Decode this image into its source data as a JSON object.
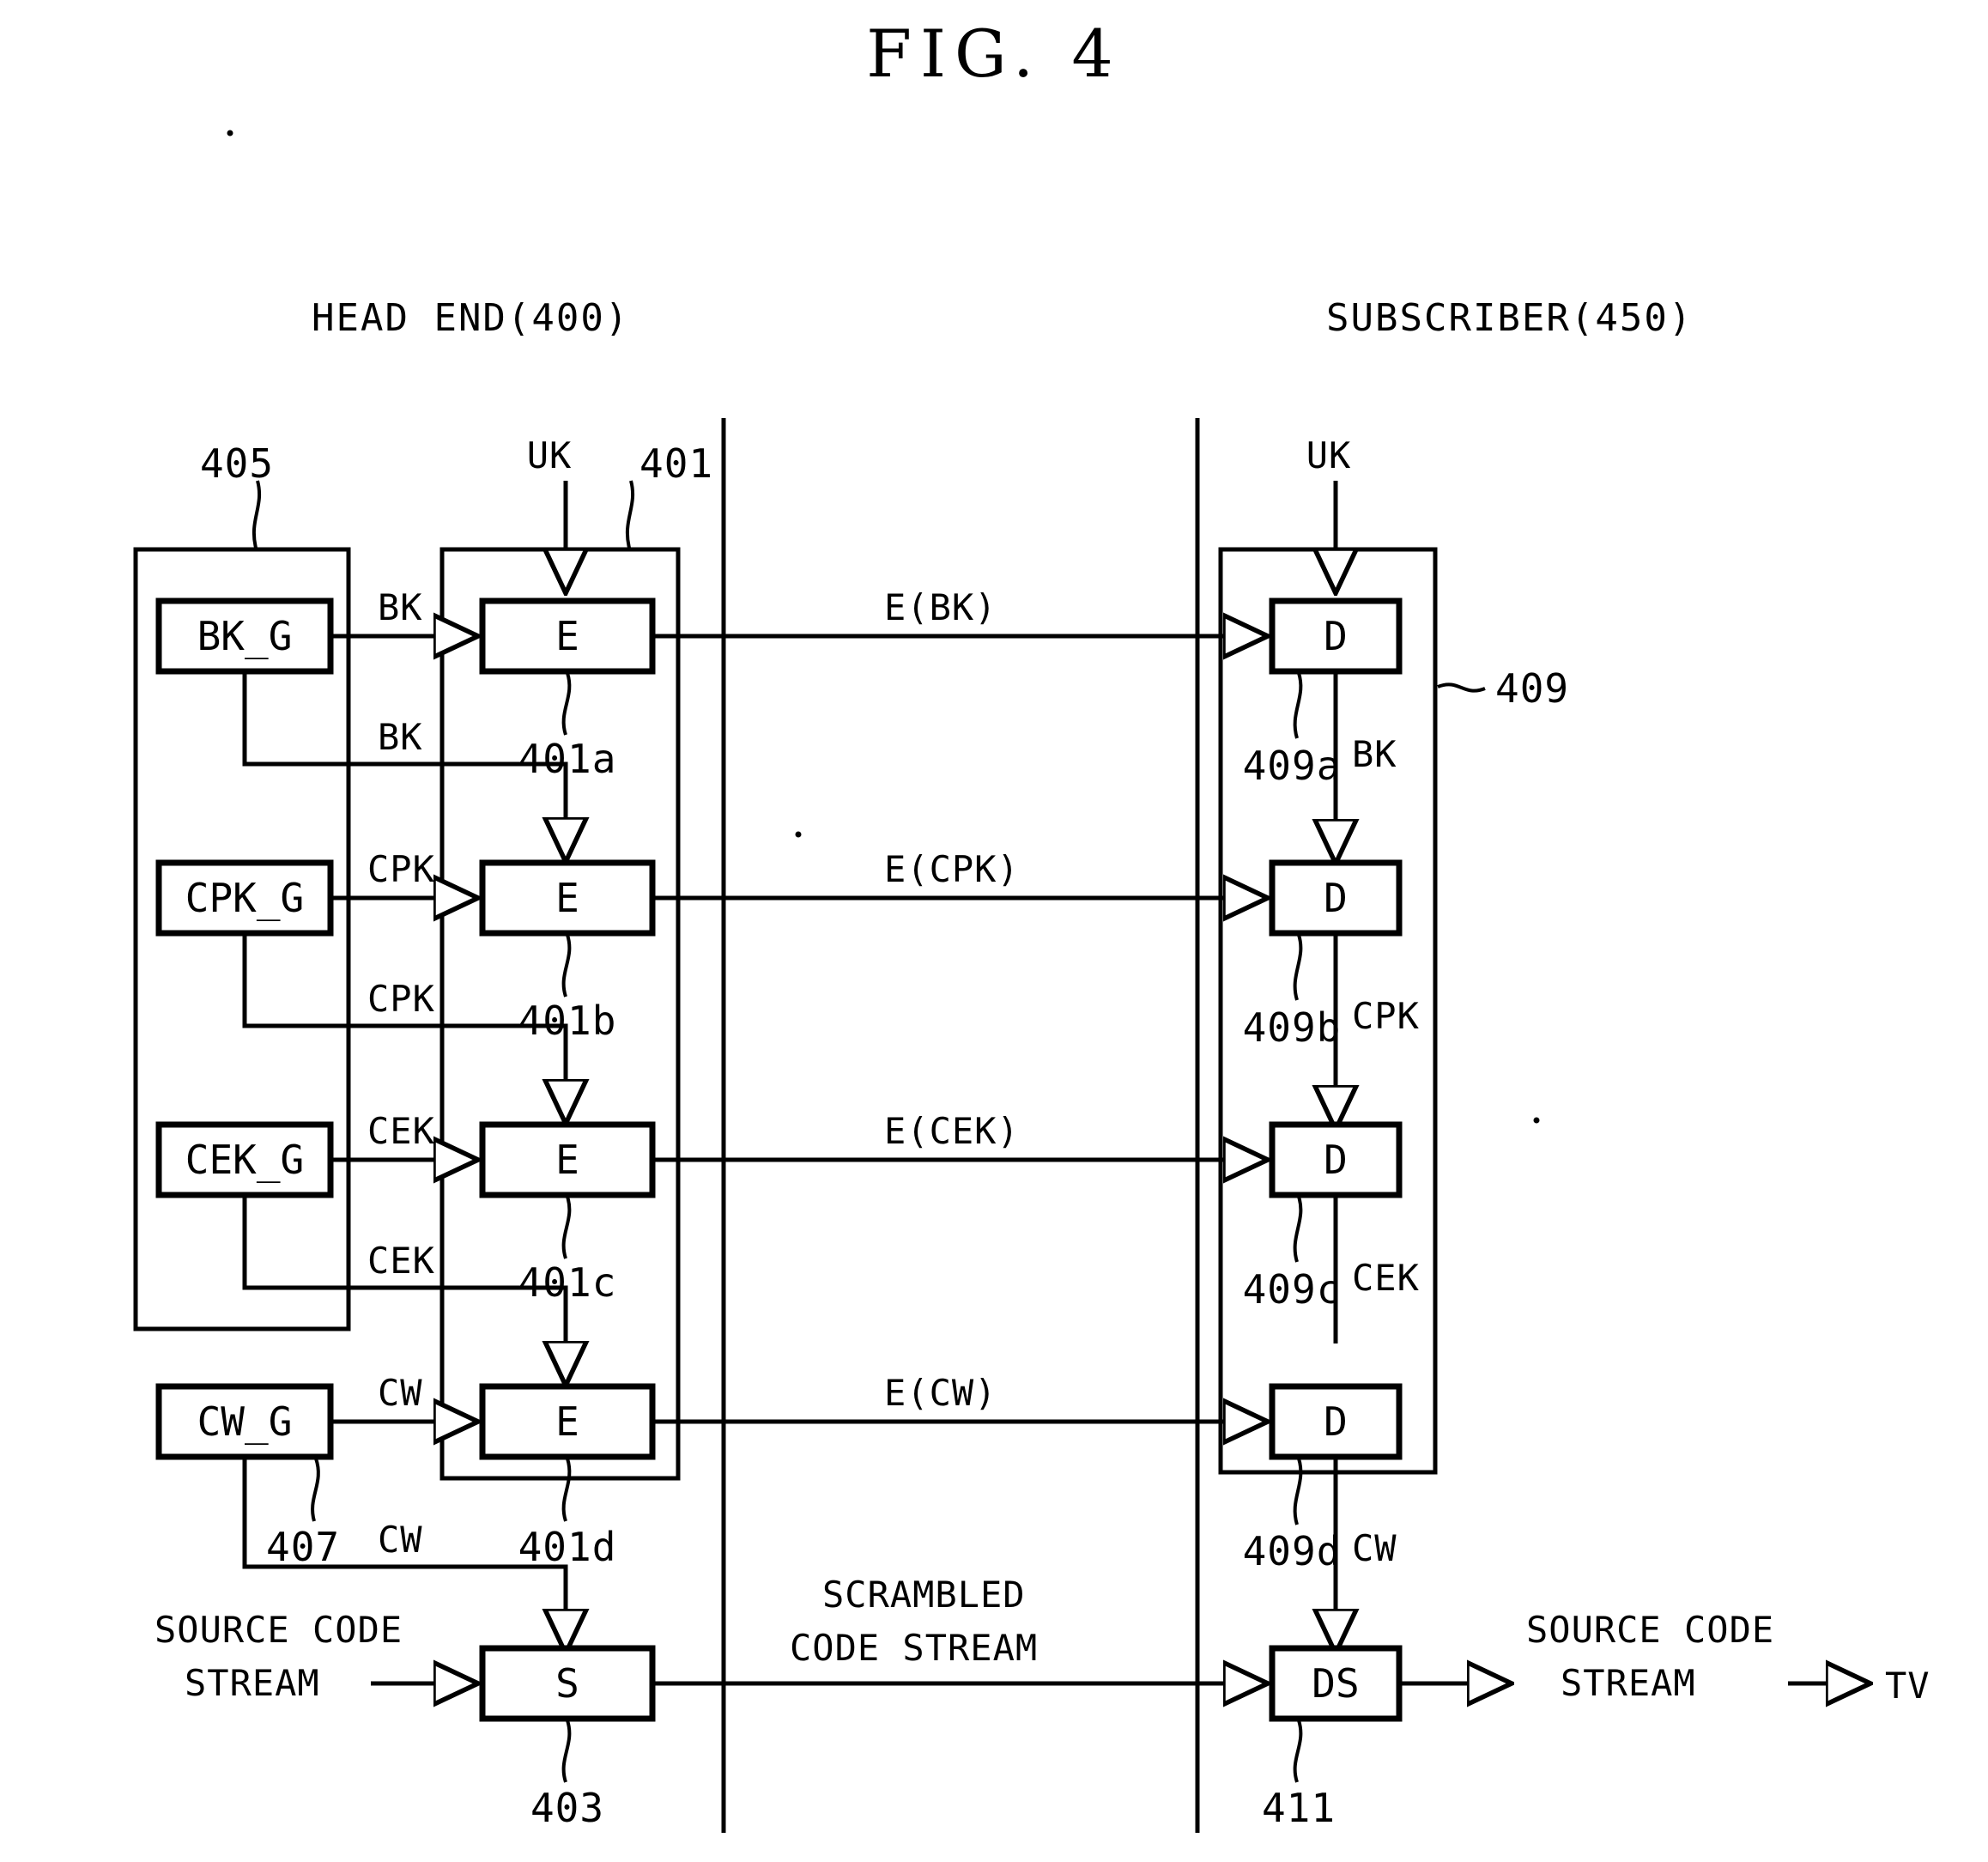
{
  "figure": {
    "title": "FIG. 4",
    "type": "patent-block-diagram"
  },
  "sections": {
    "left_header": "HEAD END(400)",
    "right_header": "SUBSCRIBER(450)"
  },
  "head_end": {
    "generator_group_ref": "405",
    "encryptor_group_ref": "401",
    "generators": [
      {
        "label": "BK_G",
        "out_signal": "BK"
      },
      {
        "label": "CPK_G",
        "out_signal": "CPK"
      },
      {
        "label": "CEK_G",
        "out_signal": "CEK"
      },
      {
        "label": "CW_G",
        "out_signal": "CW",
        "ref": "407"
      }
    ],
    "encryptors": [
      {
        "label": "E",
        "ref": "401a",
        "key_in": "UK",
        "out": "E(BK)"
      },
      {
        "label": "E",
        "ref": "401b",
        "key_in": "BK",
        "out": "E(CPK)"
      },
      {
        "label": "E",
        "ref": "401c",
        "key_in": "CPK",
        "out": "E(CEK)"
      },
      {
        "label": "E",
        "ref": "401d",
        "key_in": "CEK",
        "out": "E(CW)"
      }
    ],
    "scrambler": {
      "label": "S",
      "ref": "403",
      "key_in": "CW",
      "in_text_line1": "SOURCE CODE",
      "in_text_line2": "STREAM"
    },
    "uk_label": "UK"
  },
  "channel": {
    "streams": [
      "E(BK)",
      "E(CPK)",
      "E(CEK)",
      "E(CW)"
    ],
    "scrambled_line1": "SCRAMBLED",
    "scrambled_line2": "CODE STREAM"
  },
  "subscriber": {
    "decryptor_group_ref": "409",
    "uk_label": "UK",
    "decryptors": [
      {
        "label": "D",
        "ref": "409a",
        "out_signal": "BK"
      },
      {
        "label": "D",
        "ref": "409b",
        "out_signal": "CPK"
      },
      {
        "label": "D",
        "ref": "409c",
        "out_signal": "CEK"
      },
      {
        "label": "D",
        "ref": "409d",
        "out_signal": "CW"
      }
    ],
    "descrambler": {
      "label": "DS",
      "ref": "411"
    },
    "output_line1": "SOURCE CODE",
    "output_line2": "STREAM",
    "sink": "TV"
  }
}
